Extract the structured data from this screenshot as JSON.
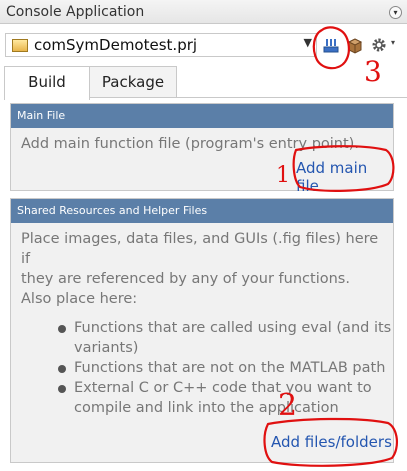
{
  "window": {
    "title": "Console Application"
  },
  "project": {
    "name": "comSymDemotest.prj"
  },
  "toolbar": {
    "icons": [
      "package-settings-icon",
      "package-box-icon",
      "gear-icon"
    ]
  },
  "tabs": [
    {
      "label": "Build",
      "active": true
    },
    {
      "label": "Package",
      "active": false
    }
  ],
  "main_file": {
    "header": "Main File",
    "description": "Add main function file (program's entry point).",
    "link": "Add main file"
  },
  "shared": {
    "header": "Shared Resources and Helper Files",
    "description_line1": "Place images, data files, and GUIs (.fig files) here if",
    "description_line2": "they are referenced by any of your functions.",
    "also": "Also place here:",
    "bullets": [
      [
        "Functions that are called using eval (and its",
        "variants)"
      ],
      [
        "Functions that are not on the MATLAB path"
      ],
      [
        "External C or C++ code that you want to",
        "compile and link into the application"
      ]
    ],
    "link": "Add files/folders"
  },
  "annotations": {
    "one": "1",
    "two": "2",
    "three": "3"
  },
  "colors": {
    "panel_header": "#5b7fa8",
    "link": "#2456b0",
    "annotation": "#e01010"
  }
}
